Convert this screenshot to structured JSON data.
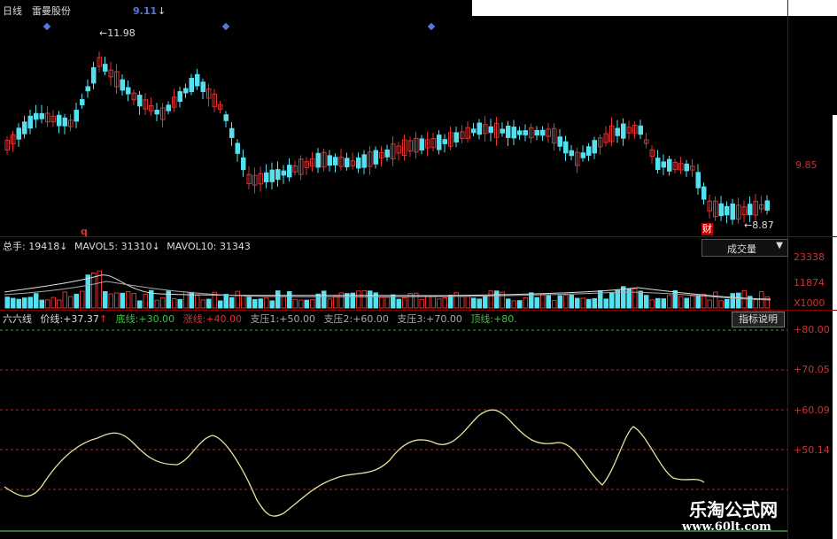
{
  "header": {
    "period": "日线",
    "stock_name": "雷曼股份",
    "marker_price": "9.11",
    "marker_arrow": "↓"
  },
  "price_panel": {
    "high_label": "11.98",
    "low_label": "8.87",
    "axis_label": "9.85",
    "cai_marker": "财",
    "q_marker": "q"
  },
  "volume_panel": {
    "total_label": "总手:",
    "total_value": "19418",
    "total_arrow": "↓",
    "mavol5_label": "MAVOL5:",
    "mavol5_value": "31310",
    "mavol5_arrow": "↓",
    "mavol10_label": "MAVOL10:",
    "mavol10_value": "31343",
    "dropdown_label": "成交量",
    "dropdown_arrow": "▼",
    "axis": [
      "23338",
      "11874",
      "X1000"
    ]
  },
  "indicator_panel": {
    "name": "六六线",
    "price_line": "价线:",
    "price_value": "+37.37",
    "price_arrow": "↑",
    "base_label": "底线:",
    "base_value": "+30.00",
    "rise_label": "涨线:",
    "rise_value": "+40.00",
    "s1_label": "支压1:",
    "s1_value": "+50.00",
    "s2_label": "支压2:",
    "s2_value": "+60.00",
    "s3_label": "支压3:",
    "s3_value": "+70.00",
    "top_label": "顶线:",
    "top_value": "+80.",
    "help_button": "指标说明",
    "axis": [
      "+80.00",
      "+70.05",
      "+60.09",
      "+50.14"
    ]
  },
  "watermark": {
    "title": "乐淘公式网",
    "url": "www.60lt.com"
  },
  "colors": {
    "up": "#e03030",
    "down": "#55e0f0",
    "grid": "#8a0000",
    "curve": "#e8e0a0"
  }
}
